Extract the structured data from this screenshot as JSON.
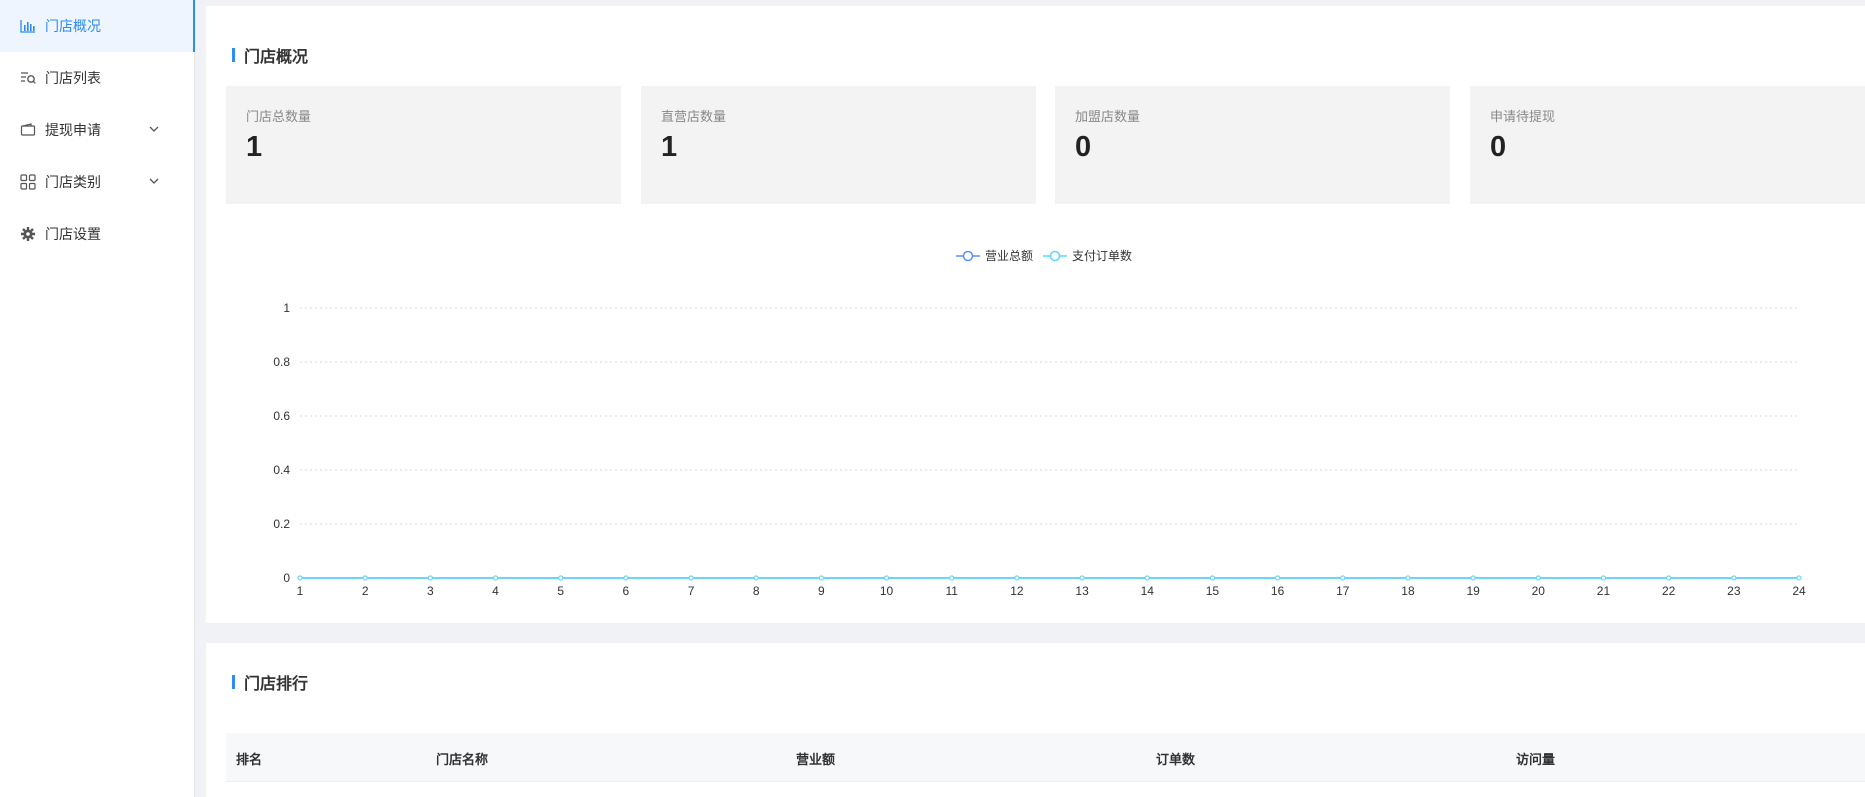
{
  "sidebar": {
    "items": [
      {
        "label": "门店概况",
        "icon": "bar-chart-icon",
        "active": true
      },
      {
        "label": "门店列表",
        "icon": "list-search-icon"
      },
      {
        "label": "提现申请",
        "icon": "wallet-icon",
        "expandable": true
      },
      {
        "label": "门店类别",
        "icon": "grid-icon",
        "expandable": true
      },
      {
        "label": "门店设置",
        "icon": "gear-icon"
      }
    ]
  },
  "overview": {
    "title": "门店概况",
    "stats": [
      {
        "label": "门店总数量",
        "value": "1"
      },
      {
        "label": "直营店数量",
        "value": "1"
      },
      {
        "label": "加盟店数量",
        "value": "0"
      },
      {
        "label": "申请待提现",
        "value": "0"
      }
    ]
  },
  "chart_data": {
    "type": "line",
    "x": [
      "1",
      "2",
      "3",
      "4",
      "5",
      "6",
      "7",
      "8",
      "9",
      "10",
      "11",
      "12",
      "13",
      "14",
      "15",
      "16",
      "17",
      "18",
      "19",
      "20",
      "21",
      "22",
      "23",
      "24"
    ],
    "yticks": [
      "0",
      "0.2",
      "0.4",
      "0.6",
      "0.8",
      "1"
    ],
    "ylim": [
      0,
      1
    ],
    "grid": true,
    "legend_position": "top-center",
    "series": [
      {
        "name": "营业总额",
        "color": "#5b8ff9",
        "values": [
          0,
          0,
          0,
          0,
          0,
          0,
          0,
          0,
          0,
          0,
          0,
          0,
          0,
          0,
          0,
          0,
          0,
          0,
          0,
          0,
          0,
          0,
          0,
          0
        ]
      },
      {
        "name": "支付订单数",
        "color": "#5ad8f6",
        "values": [
          0,
          0,
          0,
          0,
          0,
          0,
          0,
          0,
          0,
          0,
          0,
          0,
          0,
          0,
          0,
          0,
          0,
          0,
          0,
          0,
          0,
          0,
          0,
          0
        ]
      }
    ]
  },
  "ranking": {
    "title": "门店排行",
    "columns": [
      "排名",
      "门店名称",
      "营业额",
      "订单数",
      "访问量"
    ]
  }
}
